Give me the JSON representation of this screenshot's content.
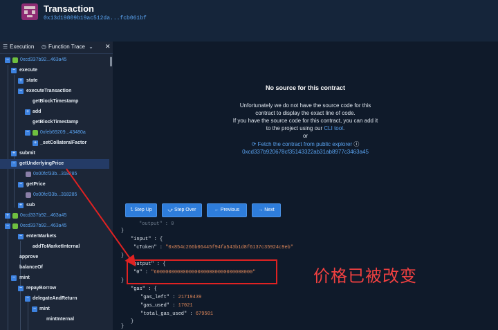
{
  "header": {
    "title": "Transaction",
    "hash": "0x13d19809b19ac512da...fcb061bf"
  },
  "panel": {
    "tab_execution": "Execution",
    "tab_function_trace": "Function Trace",
    "tree": [
      {
        "label": "0xcd337b92...463a45"
      },
      {
        "label": "execute"
      },
      {
        "label": "state"
      },
      {
        "label": "executeTransaction"
      },
      {
        "label": "getBlockTimestamp"
      },
      {
        "label": "add"
      },
      {
        "label": "getBlockTimestamp"
      },
      {
        "label": "0xfeb69209...43480a"
      },
      {
        "label": "_setCollateralFactor"
      },
      {
        "label": "submit"
      },
      {
        "label": "getUnderlyingPrice"
      },
      {
        "label": "0x00fcf33b...318285"
      },
      {
        "label": "getPrice"
      },
      {
        "label": "0x00fcf33b...318285"
      },
      {
        "label": "sub"
      },
      {
        "label": "0xcd337b92...463a45"
      },
      {
        "label": "0xcd337b92...463a45"
      },
      {
        "label": "enterMarkets"
      },
      {
        "label": "addToMarketInternal"
      },
      {
        "label": "approve"
      },
      {
        "label": "balanceOf"
      },
      {
        "label": "mint"
      },
      {
        "label": "repayBorrow"
      },
      {
        "label": "delegateAndReturn"
      },
      {
        "label": "mint"
      },
      {
        "label": "mintInternal"
      }
    ]
  },
  "nosource": {
    "title": "No source for this contract",
    "line1": "Unfortunately we do not have the source code for this",
    "line2": "contract to display the exact line of code.",
    "line3": "If you have the source code for this contract, you can add it",
    "line4a": "to the project using our ",
    "cli_link": "CLI tool",
    "line4b": ".",
    "or": "or",
    "fetch_link": "Fetch the contract from public explorer",
    "address": "0xcd337b920678cf35143322ab31ab8977c3463a45"
  },
  "toolbar": {
    "step_up": "Step Up",
    "step_over": "Step Over",
    "previous": "Previous",
    "next": "Next"
  },
  "code": {
    "l0": "\"output\" : 0",
    "l1": "\"input\" : {",
    "l2_key": "\"cToken\"",
    "l2_val": "\"0x854c266b06445f94fa543b1d8f6137c35924c9eb\"",
    "l3": "}",
    "l4": "\"output\" : {",
    "l5_key": "\"0\"",
    "l5_val": "\"6000000000000000000000000000000000\"",
    "l6": "}",
    "l7": "\"gas\" : {",
    "l8_key": "\"gas_left\"",
    "l8_val": "21719439",
    "l9_key": "\"gas_used\"",
    "l9_val": "17021",
    "l10_key": "\"total_gas_used\"",
    "l10_val": "679501",
    "l11": "}",
    "l12": "}"
  },
  "annotation": {
    "text": "价格已被改变",
    "color": "#e02222"
  },
  "colors": {
    "background": "#0f1a2a",
    "panel": "#1c2637",
    "accent": "#2e7ddb",
    "link": "#5aa3f0"
  }
}
